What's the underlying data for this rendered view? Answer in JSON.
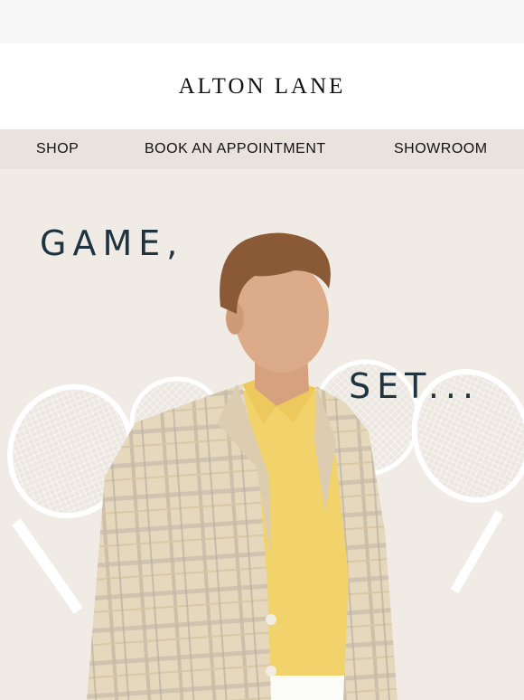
{
  "brand": {
    "logo_text": "ALTON LANE"
  },
  "nav": {
    "items": [
      {
        "label": "SHOP"
      },
      {
        "label": "BOOK AN APPOINTMENT"
      },
      {
        "label": "SHOWROOM"
      }
    ]
  },
  "hero": {
    "headline_1": "GAME,",
    "headline_2": "SET..."
  },
  "colors": {
    "header_bg": "#ffffff",
    "nav_bg": "#e9e3de",
    "hero_bg": "#f0ece5",
    "headline": "#1f3441"
  }
}
